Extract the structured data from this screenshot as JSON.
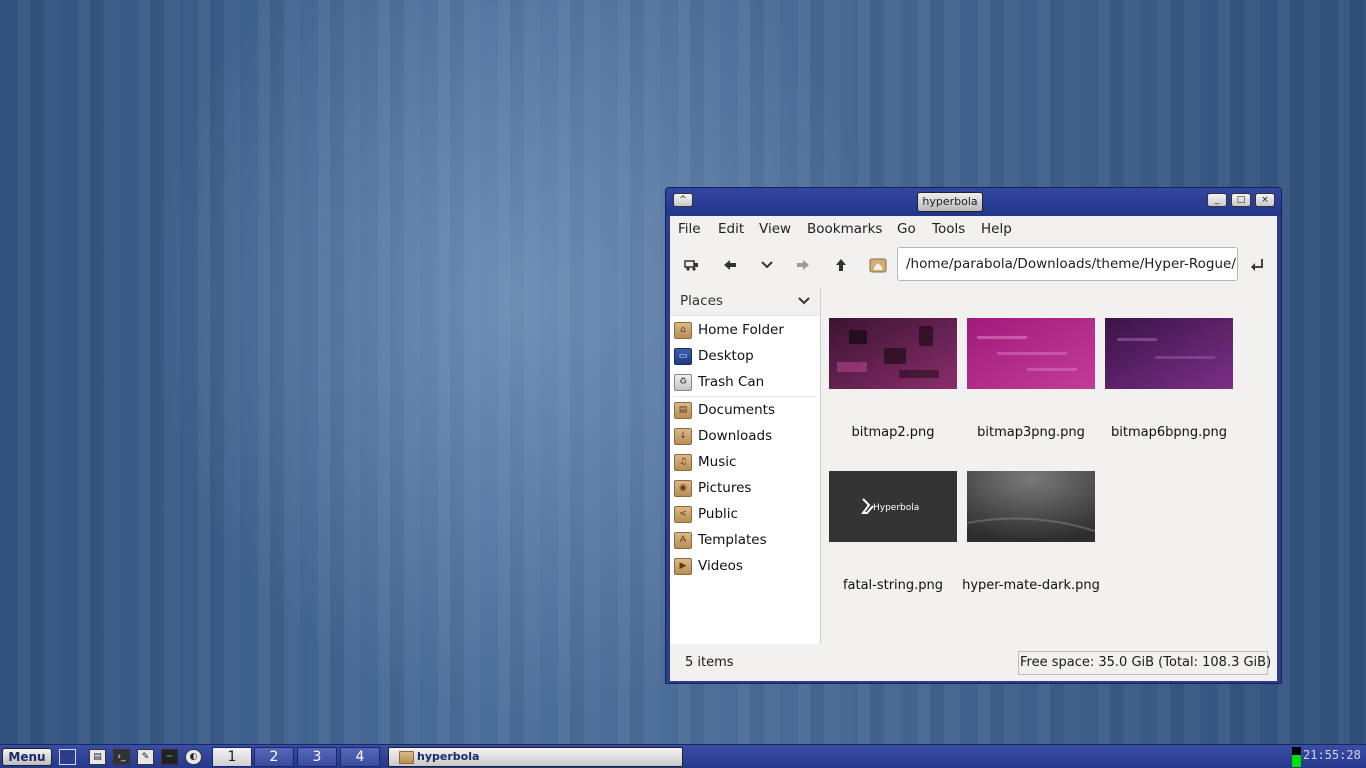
{
  "window": {
    "title": "hyperbola",
    "buttons": {
      "roll": "^",
      "minimize": "_",
      "maximize": "□",
      "close": "×"
    }
  },
  "menubar": [
    "File",
    "Edit",
    "View",
    "Bookmarks",
    "Go",
    "Tools",
    "Help"
  ],
  "toolbar": {
    "path": "/home/parabola/Downloads/theme/Hyper-Rogue/h",
    "icons": [
      "toggle-pathbar-icon",
      "back-arrow-icon",
      "history-dropdown-icon",
      "forward-arrow-icon",
      "up-arrow-icon",
      "home-icon",
      "go-enter-icon"
    ]
  },
  "sidebar": {
    "header": "Places",
    "items": [
      {
        "label": "Home Folder",
        "icon": "home-folder-icon"
      },
      {
        "label": "Desktop",
        "icon": "desktop-icon"
      },
      {
        "label": "Trash Can",
        "icon": "trash-icon"
      },
      {
        "label": "Documents",
        "icon": "documents-folder-icon"
      },
      {
        "label": "Downloads",
        "icon": "downloads-folder-icon"
      },
      {
        "label": "Music",
        "icon": "music-folder-icon"
      },
      {
        "label": "Pictures",
        "icon": "pictures-folder-icon"
      },
      {
        "label": "Public",
        "icon": "public-folder-icon"
      },
      {
        "label": "Templates",
        "icon": "templates-folder-icon"
      },
      {
        "label": "Videos",
        "icon": "videos-folder-icon"
      }
    ]
  },
  "files": [
    {
      "name": "bitmap2.png",
      "colors": [
        "#3b1430",
        "#8a2d6d"
      ]
    },
    {
      "name": "bitmap3png.png",
      "colors": [
        "#a01c7a",
        "#c43b98"
      ]
    },
    {
      "name": "bitmap6bpng.png",
      "colors": [
        "#3a1448",
        "#7b2f86"
      ]
    },
    {
      "name": "fatal-string.png",
      "thumb_text": "Hyperbola",
      "colors": [
        "#232323",
        "#3f3f3f"
      ]
    },
    {
      "name": "hyper-mate-dark.png",
      "colors": [
        "#2d2d2d",
        "#7a7a7a"
      ]
    }
  ],
  "status": {
    "count": "5 items",
    "free_space": "Free space: 35.0 GiB (Total: 108.3 GiB)"
  },
  "taskbar": {
    "menu_label": "Menu",
    "workspaces": [
      "1",
      "2",
      "3",
      "4"
    ],
    "active_workspace": "1",
    "task_label": "hyperbola",
    "clock": "21:55:28"
  }
}
